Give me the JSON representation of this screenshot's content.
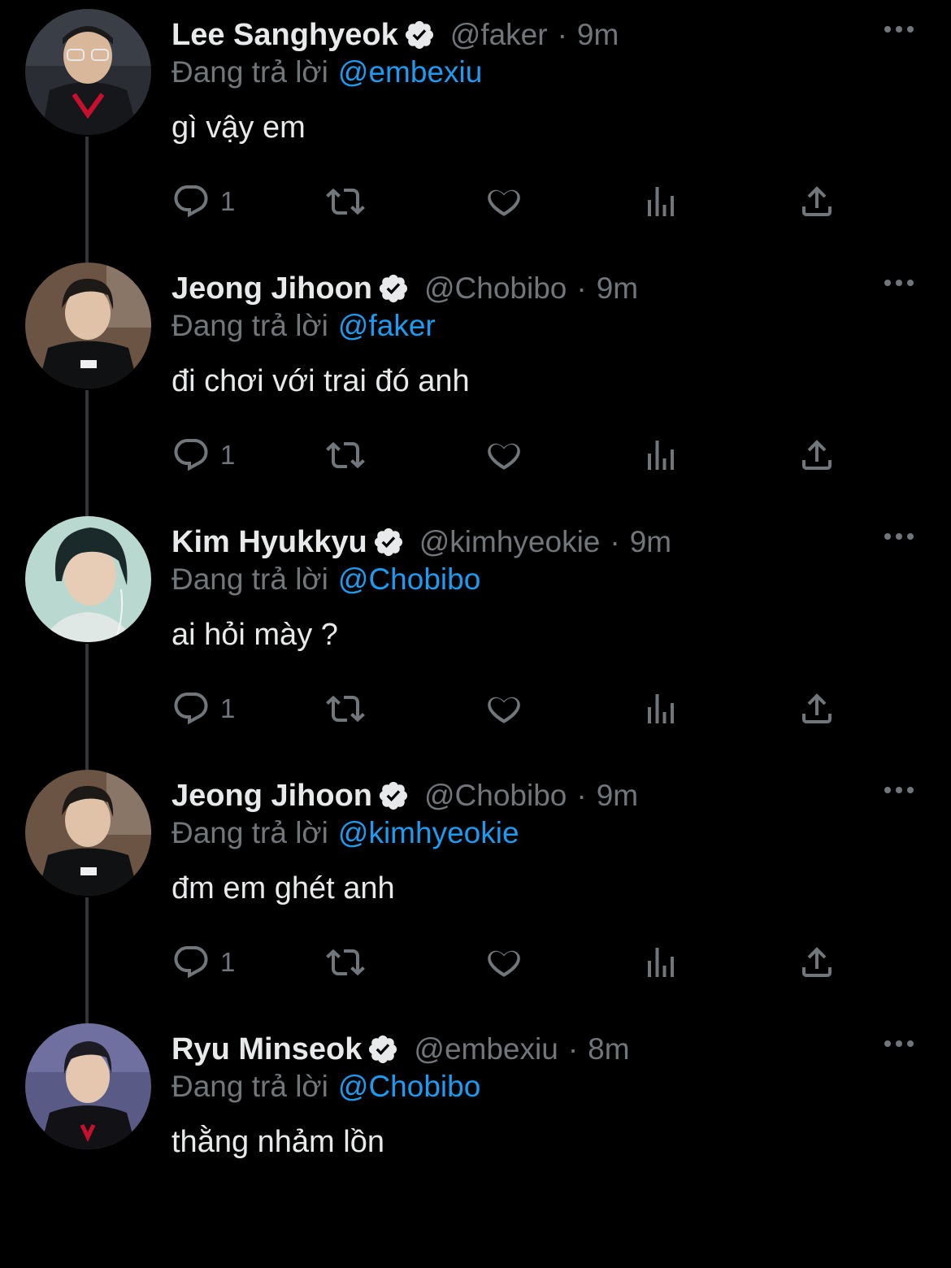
{
  "tweets": [
    {
      "name": "Lee Sanghyeok",
      "handle": "@faker",
      "separator": "·",
      "time": "9m",
      "reply_prefix": "Đang trả lời",
      "reply_to": "@embexiu",
      "text": "gì vậy em",
      "reply_count": "1"
    },
    {
      "name": "Jeong Jihoon",
      "handle": "@Chobibo",
      "separator": "·",
      "time": "9m",
      "reply_prefix": "Đang trả lời",
      "reply_to": "@faker",
      "text": "đi chơi với trai đó anh",
      "reply_count": "1"
    },
    {
      "name": "Kim Hyukkyu",
      "handle": "@kimhyeokie",
      "separator": "·",
      "time": "9m",
      "reply_prefix": "Đang trả lời",
      "reply_to": "@Chobibo",
      "text": "ai hỏi mày ?",
      "reply_count": "1"
    },
    {
      "name": "Jeong Jihoon",
      "handle": "@Chobibo",
      "separator": "·",
      "time": "9m",
      "reply_prefix": "Đang trả lời",
      "reply_to": "@kimhyeokie",
      "text": "đm em ghét anh",
      "reply_count": "1"
    },
    {
      "name": "Ryu Minseok",
      "handle": "@embexiu",
      "separator": "·",
      "time": "8m",
      "reply_prefix": "Đang trả lời",
      "reply_to": "@Chobibo",
      "text": "thằng nhảm lồn"
    }
  ],
  "icons": {
    "verified": "verified-badge-icon",
    "more": "more-options-icon",
    "reply": "reply-icon",
    "retweet": "retweet-icon",
    "like": "heart-icon",
    "views": "views-chart-icon",
    "share": "share-icon"
  },
  "colors": {
    "background": "#000000",
    "text_primary": "#e7e9ea",
    "text_secondary": "#71767b",
    "link": "#1d9bf0",
    "thread_line": "#333639"
  }
}
